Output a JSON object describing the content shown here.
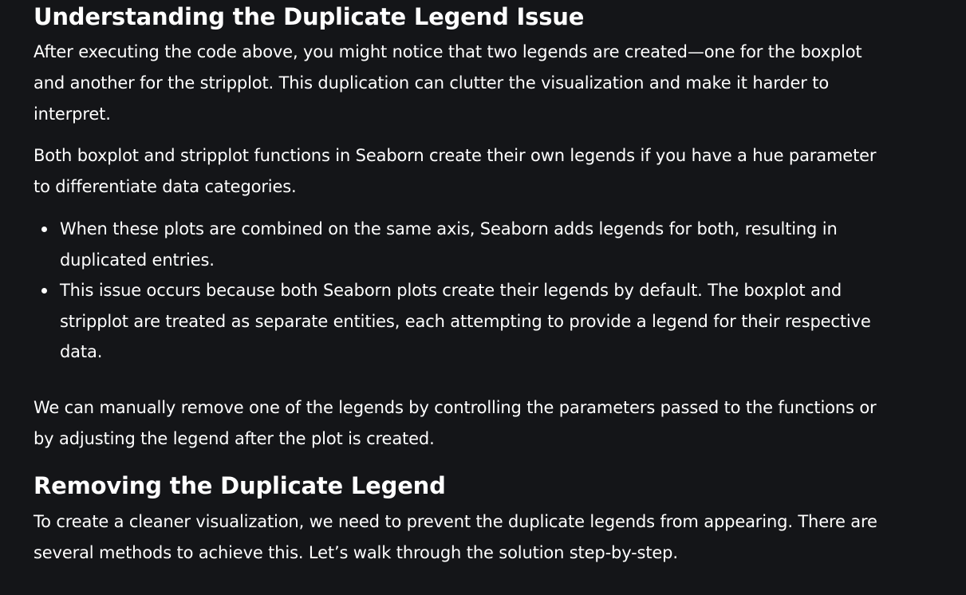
{
  "section1": {
    "heading": "Understanding the Duplicate Legend Issue",
    "paragraph1": "After executing the code above, you might notice that two legends are created—one for the boxplot and another for the stripplot. This duplication can clutter the visualization and make it harder to interpret.",
    "paragraph2": "Both boxplot and stripplot functions in Seaborn create their own legends if you have a hue parameter to differentiate data categories.",
    "bullets": [
      "When these plots are combined on the same axis, Seaborn adds legends for both, resulting in duplicated entries.",
      "This issue occurs because both Seaborn plots create their legends by default. The boxplot and stripplot are treated as separate entities, each attempting to provide a legend for their respective data."
    ],
    "paragraph3": "We can manually remove one of the legends by controlling the parameters passed to the functions or by adjusting the legend after the plot is created."
  },
  "section2": {
    "heading": "Removing the Duplicate Legend",
    "paragraph1": "To create a cleaner visualization, we need to prevent the duplicate legends from appearing. There are several methods to achieve this. Let’s walk through the solution step-by-step."
  },
  "colors": {
    "background": "#141518",
    "text": "#ffffff"
  }
}
